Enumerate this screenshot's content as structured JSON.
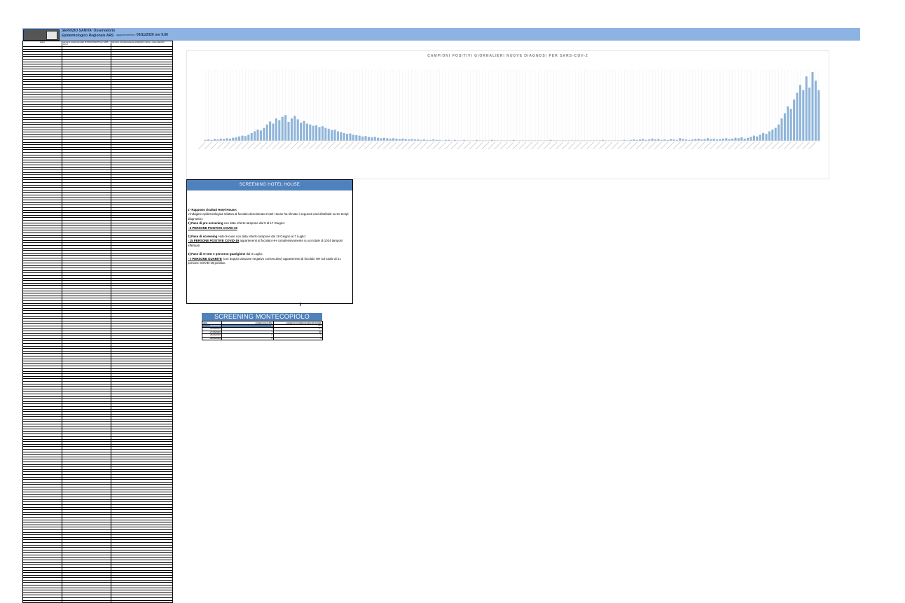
{
  "header": {
    "org_line1": "SERVIZIO SANITA' Osservatorio",
    "org_line2": "Epidemiologico Regionale ARS",
    "update_label": "aggiornamento:",
    "update_value": "09/11/2020 ore 9.00"
  },
  "daily_table": {
    "col_date": "giorno",
    "col_positive": "campioni risultati giornalieri NUOVE DIAGNOSI per SARS-CoV-2",
    "col_tested": "campioni complessivamente testati/giorno (prime e nuove diagnosi)"
  },
  "chart_data": {
    "type": "bar",
    "title": "CAMPIONI POSITIVI GIORNALIERI NUOVE DIAGNOSI PER SARS-COV-2",
    "xlabel": "",
    "ylabel": "",
    "color": "#8eb4d9",
    "values": [
      2,
      3,
      2,
      4,
      3,
      5,
      4,
      6,
      5,
      7,
      8,
      10,
      12,
      11,
      14,
      18,
      22,
      26,
      24,
      30,
      38,
      45,
      40,
      52,
      48,
      56,
      60,
      44,
      52,
      58,
      50,
      42,
      46,
      40,
      38,
      35,
      36,
      32,
      34,
      30,
      28,
      25,
      26,
      22,
      20,
      18,
      16,
      17,
      14,
      13,
      12,
      10,
      11,
      9,
      8,
      9,
      7,
      6,
      7,
      6,
      5,
      6,
      5,
      4,
      5,
      4,
      3,
      4,
      3,
      3,
      2,
      3,
      2,
      2,
      3,
      2,
      2,
      1,
      2,
      2,
      1,
      2,
      1,
      1,
      2,
      1,
      1,
      1,
      2,
      1,
      1,
      1,
      1,
      2,
      1,
      1,
      1,
      1,
      1,
      1,
      2,
      1,
      1,
      1,
      1,
      1,
      1,
      1,
      1,
      1,
      1,
      1,
      2,
      1,
      1,
      1,
      1,
      1,
      1,
      1,
      1,
      1,
      1,
      1,
      1,
      1,
      1,
      1,
      1,
      2,
      1,
      1,
      1,
      1,
      1,
      1,
      2,
      1,
      2,
      3,
      2,
      3,
      4,
      2,
      3,
      5,
      3,
      4,
      2,
      3,
      2,
      4,
      3,
      2,
      6,
      4,
      3,
      2,
      3,
      4,
      5,
      3,
      4,
      6,
      4,
      5,
      3,
      4,
      5,
      6,
      4,
      5,
      7,
      6,
      8,
      5,
      7,
      9,
      12,
      10,
      14,
      18,
      16,
      22,
      26,
      30,
      38,
      52,
      64,
      80,
      74,
      96,
      112,
      130,
      118,
      150,
      124,
      160,
      140,
      118
    ]
  },
  "hotel_house": {
    "header": "SCREENING HOTEL HOUSE",
    "title": "1° Rapporto  risultati Hotel House:",
    "intro": "L'indagine epidemiologica relativa al focolaio denominato Hotel House ha rilevato i seguenti casi distribuiti su tre tempi diagnostici:",
    "p1_bold": "1) Fase di pre-screening",
    "p1_text": " con data referto tampone dal 9 al 17 Giugno:",
    "p1_result": "- 6 PERSONE POSITIVE COVID-19",
    "p2_bold": "2) Fase di screening",
    "p2_text": " Hotel House con data referto tampone dal 18 Giugno al 7 Luglio:",
    "p2_result": "- 15 PERSONE POSITIVE COVID-19",
    "p2_tail": " appartenenti al focolaio HH complessivamente su un totale di 1024 tamponi effettuati",
    "p3_bold": "3) Fase di re-test e percorso guarigione",
    "p3_text": " dal 3 Luglio:",
    "p3_result": "- 7 PERSONE GUARITE",
    "p3_tail": " (con doppio tampone negativo consecutivo) appartenenti al focolaio HH sul totale di 21 persone COVID-19 positive."
  },
  "montecopiolo": {
    "header": "SCREENING MONTECOPIOLO",
    "columns": [
      "data",
      "campioni positivi",
      "campioni complessivamente testati"
    ],
    "rows": [
      [
        "25/06/2020",
        "6",
        "273"
      ],
      [
        "26/06/2020",
        "1",
        "11"
      ],
      [
        "27/06/2020",
        "7",
        "98"
      ],
      [
        "28/06/2020",
        "0",
        "9"
      ],
      [
        "29/06/2020",
        "0",
        "5"
      ]
    ]
  }
}
